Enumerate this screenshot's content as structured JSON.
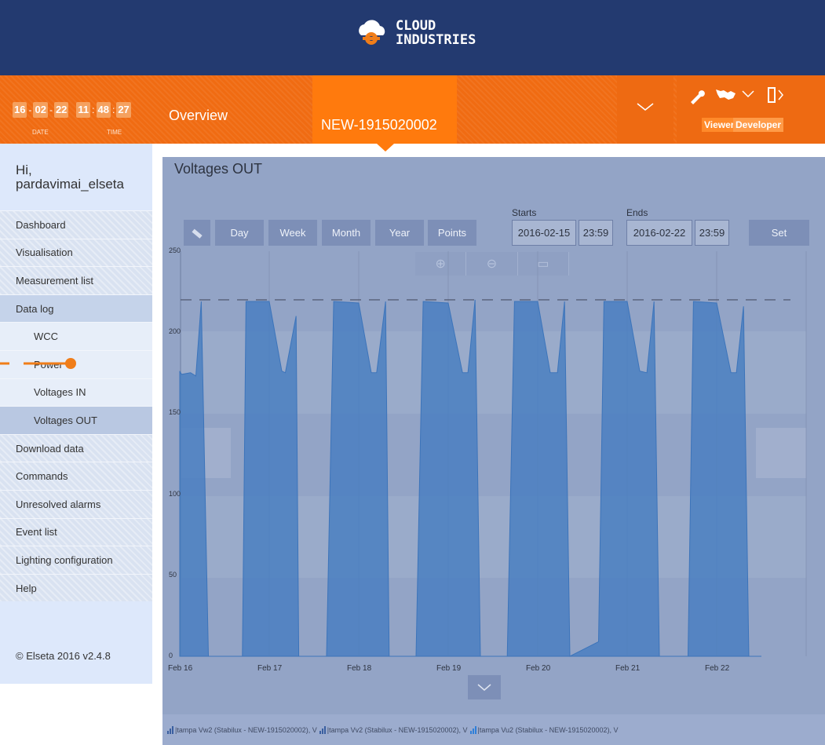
{
  "header": {
    "logo_line1": "CLOUD",
    "logo_line2": "INDUSTRIES"
  },
  "clock": {
    "date": [
      "16",
      "02",
      "22"
    ],
    "time": [
      "11",
      "48",
      "27"
    ],
    "date_label": "DATE",
    "time_label": "TIME"
  },
  "nav": {
    "overview": "Overview",
    "device": "NEW-1915020002"
  },
  "roles": {
    "viewer": "Viewer",
    "developer": "Developer"
  },
  "sidebar": {
    "greeting": "Hi,\npardavimai_elseta",
    "items": [
      {
        "label": "Dashboard"
      },
      {
        "label": "Visualisation"
      },
      {
        "label": "Measurement list"
      },
      {
        "label": "Data log"
      },
      {
        "label": "WCC"
      },
      {
        "label": "Power"
      },
      {
        "label": "Voltages IN"
      },
      {
        "label": "Voltages OUT"
      },
      {
        "label": "Download data"
      },
      {
        "label": "Commands"
      },
      {
        "label": "Unresolved alarms"
      },
      {
        "label": "Event list"
      },
      {
        "label": "Lighting configuration"
      },
      {
        "label": "Help"
      }
    ],
    "copyright": "© Elseta 2016 v2.4.8"
  },
  "page": {
    "title": "Voltages OUT"
  },
  "toolbar": {
    "day": "Day",
    "week": "Week",
    "month": "Month",
    "year": "Year",
    "points": "Points",
    "set": "Set"
  },
  "range": {
    "starts_label": "Starts",
    "ends_label": "Ends",
    "start_date": "2016-02-15",
    "start_time": "23:59",
    "end_date": "2016-02-22",
    "end_time": "23:59"
  },
  "icons": {
    "ruler": "ruler-icon",
    "zoom_in": "zoom-in-icon",
    "zoom_out": "zoom-out-icon",
    "reset": "monitor-icon",
    "wrench": "wrench-icon",
    "map": "world-map-icon",
    "logout": "logout-icon"
  },
  "colors": {
    "header": "#233a70",
    "nav": "#f06b12",
    "nav_active": "#ff7a0d",
    "series": "#4a7fc1",
    "sidebar": "#dde8fb"
  },
  "chart_data": {
    "type": "area",
    "ylim": [
      0,
      250
    ],
    "yticks": [
      "0",
      "50",
      "100",
      "150",
      "200",
      "250"
    ],
    "xticks": [
      "Feb 16",
      "Feb 17",
      "Feb 18",
      "Feb 19",
      "Feb 20",
      "Feb 21",
      "Feb 22"
    ],
    "threshold": 220,
    "series": [
      {
        "name": "|tampa Vw2 (Stabilux - NEW-1915020002), V"
      },
      {
        "name": "|tampa Vv2 (Stabilux - NEW-1915020002), V"
      },
      {
        "name": "|tampa Vu2 (Stabilux - NEW-1915020002), V"
      }
    ],
    "x_days": [
      0,
      0.02,
      0.12,
      0.18,
      0.24,
      0.32,
      0.7,
      0.74,
      1.0,
      1.14,
      1.18,
      1.3,
      1.33,
      1.64,
      1.72,
      2.0,
      2.14,
      2.2,
      2.3,
      2.34,
      2.64,
      2.72,
      3.0,
      3.16,
      3.22,
      3.3,
      3.36,
      3.66,
      3.74,
      4.0,
      4.14,
      4.22,
      4.3,
      4.36,
      4.68,
      4.74,
      5.0,
      5.14,
      5.22,
      5.3,
      5.36,
      5.68,
      5.74,
      6.0,
      6.16,
      6.22,
      6.3,
      6.36,
      6.5
    ],
    "values": [
      176,
      174,
      175,
      173,
      219,
      0,
      0,
      219,
      219,
      176,
      175,
      210,
      0,
      0,
      219,
      218,
      175,
      175,
      219,
      0,
      0,
      219,
      218,
      175,
      175,
      220,
      0,
      0,
      219,
      219,
      175,
      175,
      219,
      0,
      9,
      219,
      219,
      176,
      175,
      219,
      0,
      0,
      219,
      218,
      175,
      175,
      216,
      0,
      0
    ]
  }
}
